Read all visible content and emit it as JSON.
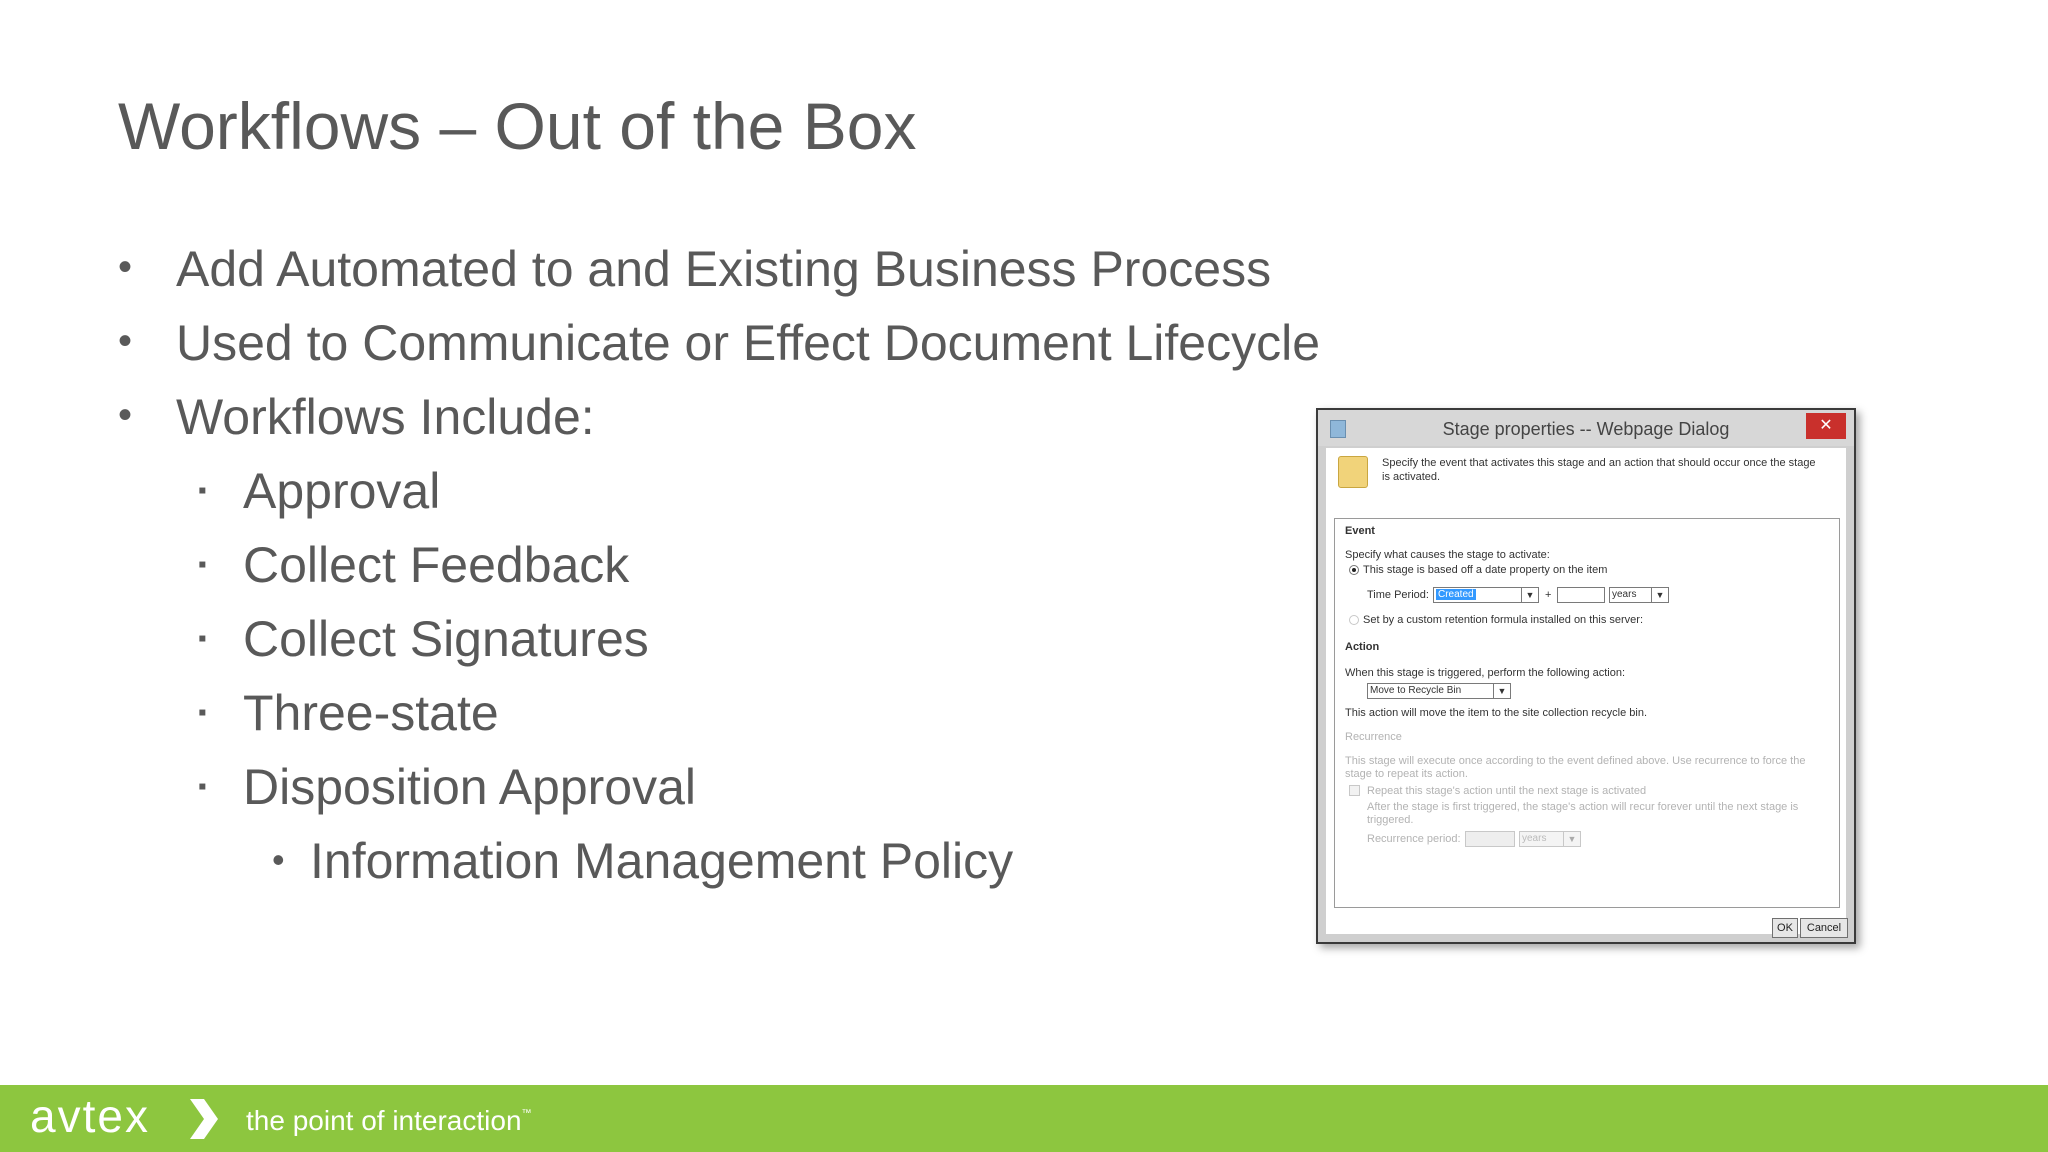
{
  "slide": {
    "title": "Workflows – Out of the Box",
    "bullets": [
      "Add Automated to and Existing Business Process",
      "Used to Communicate or Effect Document Lifecycle",
      "Workflows Include:"
    ],
    "sub_bullets": [
      "Approval",
      "Collect Feedback",
      "Collect Signatures",
      "Three-state",
      "Disposition Approval"
    ],
    "sub_sub_bullets": [
      "Information Management Policy"
    ],
    "bullet_glyph": "•",
    "sub_bullet_glyph": "▪"
  },
  "dialog": {
    "title": "Stage properties -- Webpage Dialog",
    "close_glyph": "✕",
    "intro": "Specify the event that activates this stage and an action that should occur once the stage is activated.",
    "event_heading": "Event",
    "event_prompt": "Specify what causes the stage to activate:",
    "radio_date": "This stage is based off a date property on the item",
    "time_period_label": "Time Period:",
    "time_period_value": "Created",
    "plus": "+",
    "unit_value": "years",
    "radio_formula": "Set by a custom retention formula installed on this server:",
    "action_heading": "Action",
    "action_prompt": "When this stage is triggered, perform the following action:",
    "action_value": "Move to Recycle Bin",
    "action_note": "This action will move the item to the site collection recycle bin.",
    "recurrence_heading": "Recurrence",
    "recurrence_note": "This stage will execute once according to the event defined above. Use recurrence to force the stage to repeat its action.",
    "repeat_label": "Repeat this stage's action until the next stage is activated",
    "repeat_note": "After the stage is first triggered, the stage's action will recur forever until the next stage is triggered.",
    "recurrence_period_label": "Recurrence period:",
    "recurrence_unit": "years",
    "ok_label": "OK",
    "cancel_label": "Cancel"
  },
  "footer": {
    "logo_text": "avtex",
    "tagline": "the point of interaction",
    "trademark": "™",
    "color": "#8dc63f"
  }
}
